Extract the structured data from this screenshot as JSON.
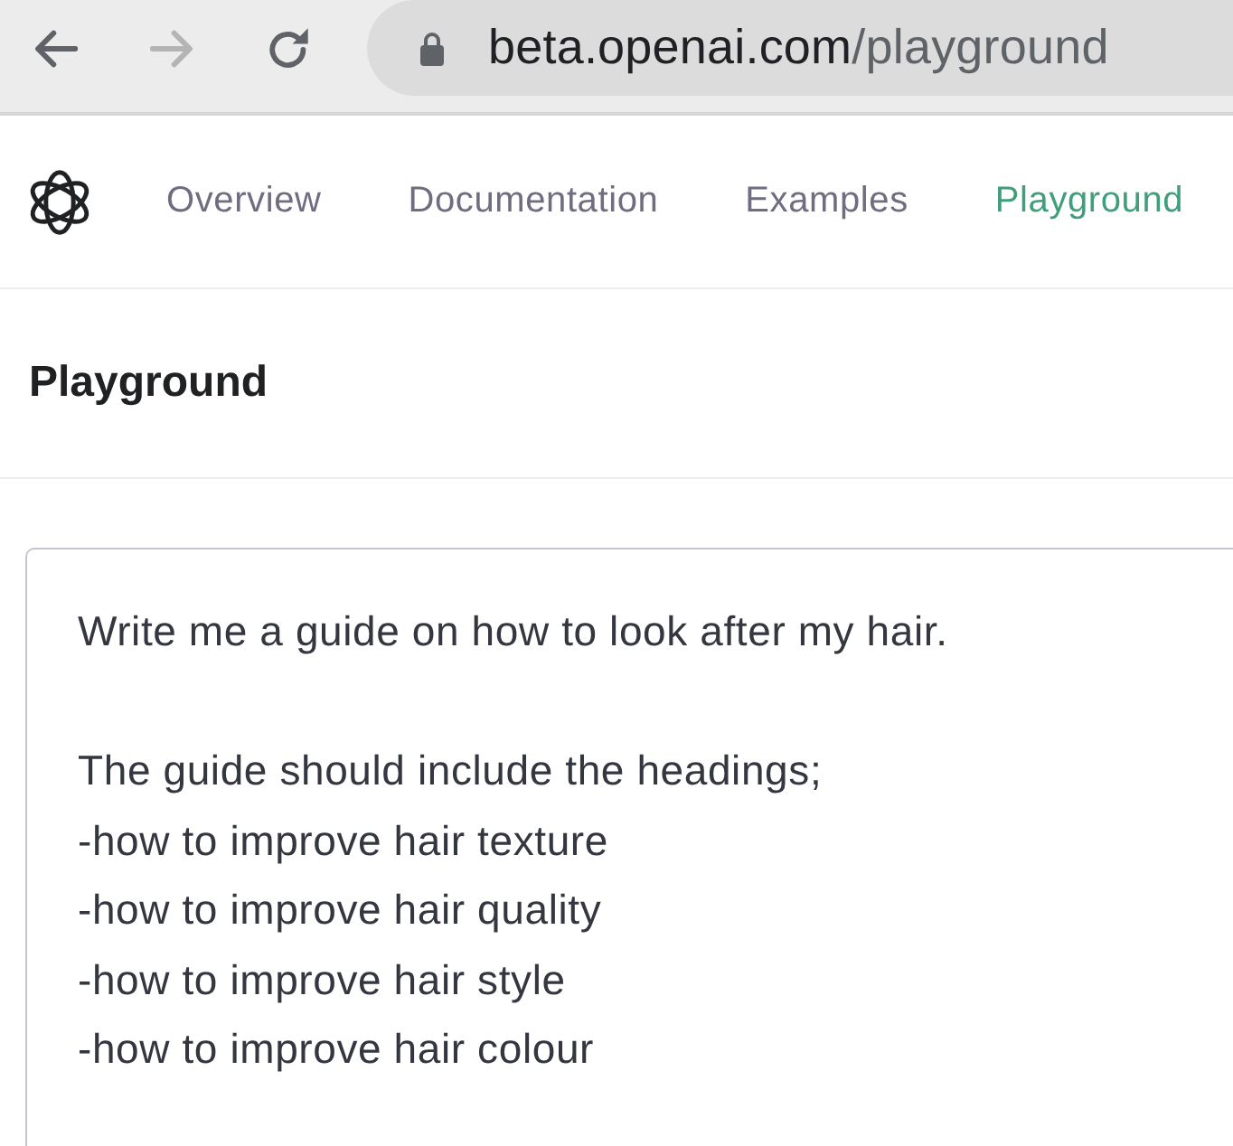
{
  "toolbar": {
    "nav_buttons": [
      {
        "kind": "back",
        "disabled": false
      },
      {
        "kind": "forward",
        "disabled": true
      },
      {
        "kind": "reload",
        "disabled": false
      }
    ],
    "address_bar": {
      "host": "beta.openai.com",
      "path": "/playground"
    }
  },
  "nav": {
    "items": [
      {
        "label": "Overview",
        "selected": false
      },
      {
        "label": "Documentation",
        "selected": false
      },
      {
        "label": "Examples",
        "selected": false
      },
      {
        "label": "Playground",
        "selected": true
      }
    ]
  },
  "page_title": "Playground",
  "prompt": {
    "value": "Write me a guide on how to look after my hair.\n\nThe guide should include the headings;\n-how to improve hair texture\n-how to improve hair quality\n-how to improve hair style\n-how to improve hair colour"
  }
}
